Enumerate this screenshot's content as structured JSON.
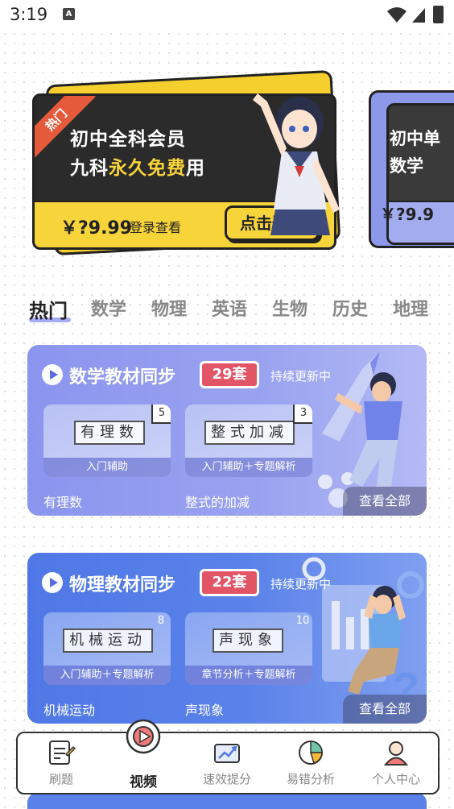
{
  "status": {
    "time": "3:19",
    "notification_glyph": "A"
  },
  "banners": [
    {
      "tag": "热门",
      "line1": "初中全科会员",
      "line2_prefix": "九科",
      "line2_highlight": "永久免费",
      "line2_suffix": "用",
      "price": "￥?9.99",
      "price_note": "登录查看",
      "button": "点击登录"
    },
    {
      "line1": "初中单",
      "line2": "数学",
      "price": "￥?9.9"
    }
  ],
  "subject_tabs": [
    "热门",
    "数学",
    "物理",
    "英语",
    "生物",
    "历史",
    "地理"
  ],
  "active_tab": "热门",
  "courses": [
    {
      "title": "数学教材同步",
      "count": "29套",
      "update_status": "持续更新中",
      "see_all": "查看全部",
      "items": [
        {
          "plate": "有理数",
          "num": "5",
          "sub": "入门辅助",
          "caption": "有理数"
        },
        {
          "plate": "整式加减",
          "num": "3",
          "sub": "入门辅助＋专题解析",
          "caption": "整式的加减"
        }
      ]
    },
    {
      "title": "物理教材同步",
      "count": "22套",
      "update_status": "持续更新中",
      "see_all": "查看全部",
      "items": [
        {
          "plate": "机械运动",
          "num": "8",
          "sub": "入门辅助＋专题解析",
          "caption": "机械运动"
        },
        {
          "plate": "声现象",
          "num": "10",
          "sub": "章节分析＋专题解析",
          "caption": "声现象"
        }
      ]
    }
  ],
  "bottom_nav": [
    {
      "label": "刷题",
      "icon": "practice-icon"
    },
    {
      "label": "视频",
      "icon": "video-icon"
    },
    {
      "label": "速效提分",
      "icon": "score-boost-icon"
    },
    {
      "label": "易错分析",
      "icon": "error-analysis-icon"
    },
    {
      "label": "个人中心",
      "icon": "profile-icon"
    }
  ],
  "active_nav": "视频",
  "colors": {
    "banner_yellow": "#f7d43a",
    "banner_dark": "#2b2b2b",
    "math_card": "#8b95ee",
    "physics_card": "#4f78e6",
    "count_badge": "#e25566"
  }
}
